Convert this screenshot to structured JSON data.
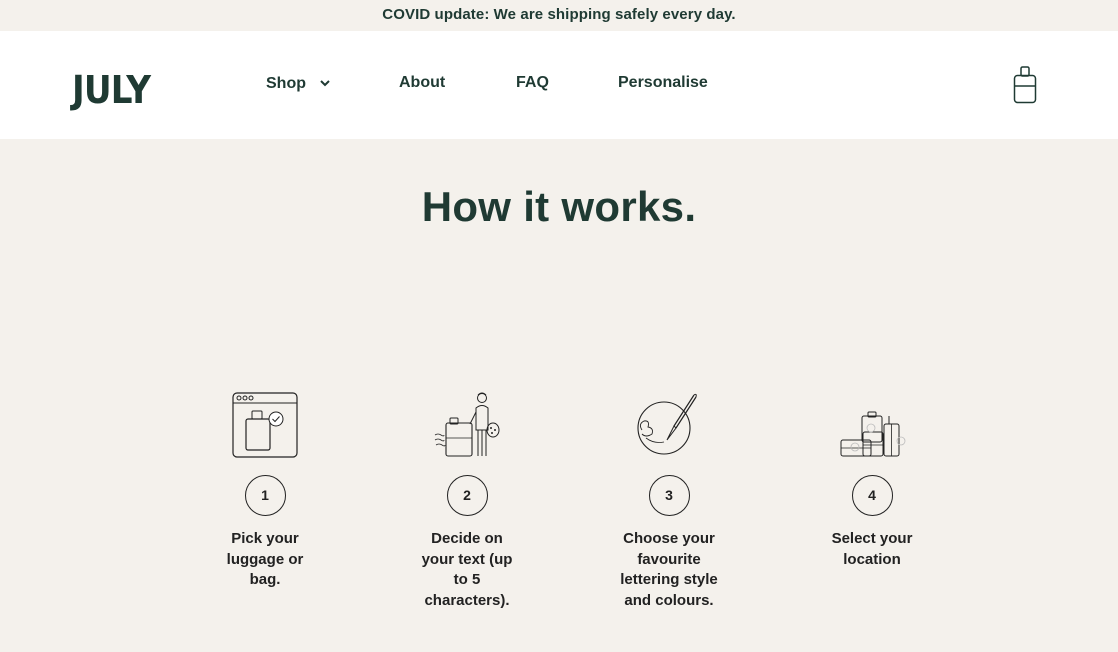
{
  "announcement": "COVID update: We are shipping safely every day.",
  "brand": {
    "logo_text": "JULY"
  },
  "nav": {
    "shop": "Shop",
    "about": "About",
    "faq": "FAQ",
    "personalise": "Personalise"
  },
  "icons": {
    "shop_chevron": "chevron-down-icon",
    "cart": "luggage-cart-icon"
  },
  "section": {
    "title": "How it works."
  },
  "steps": [
    {
      "number": "1",
      "text": "Pick your luggage or bag.",
      "icon": "browser-luggage-select-icon"
    },
    {
      "number": "2",
      "text": "Decide on your text (up to 5 characters).",
      "icon": "person-painting-luggage-icon"
    },
    {
      "number": "3",
      "text": "Choose your favourite lettering style and colours.",
      "icon": "paint-palette-brush-icon"
    },
    {
      "number": "4",
      "text": "Select your location",
      "icon": "luggage-set-icon"
    }
  ],
  "colors": {
    "primary": "#1f3a33",
    "background": "#f4f1ec",
    "header_bg": "#ffffff"
  }
}
